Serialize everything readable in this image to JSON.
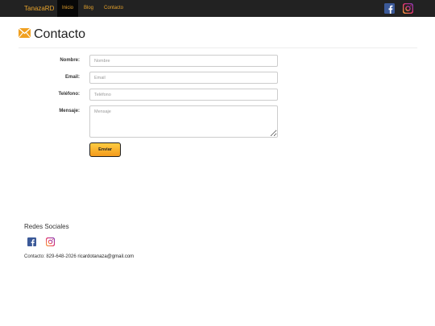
{
  "navbar": {
    "brand": "TanazaRD",
    "items": [
      {
        "label": "Inicio",
        "active": true
      },
      {
        "label": "Blog",
        "active": false
      },
      {
        "label": "Contacto",
        "active": false
      }
    ],
    "social_icons": [
      "facebook-icon",
      "instagram-icon"
    ],
    "accent_color": "#e7a32c",
    "background_color": "#222222"
  },
  "page": {
    "title": "Contacto",
    "title_icon": "envelope-icon",
    "title_icon_color": "#f0a020"
  },
  "form": {
    "name_label": "Nombre:",
    "name_placeholder": "Nombre",
    "email_label": "Email:",
    "email_placeholder": "Email",
    "phone_label": "Teléfono:",
    "phone_placeholder": "Teléfono",
    "message_label": "Mensaje:",
    "message_placeholder": "Mensaje",
    "submit_label": "Enviar",
    "submit_color": "#f7b432"
  },
  "footer": {
    "social_title": "Redes Sociales",
    "social_icons": [
      "facebook-icon",
      "instagram-icon"
    ],
    "contact_prefix": "Contacto: 829-648-2026",
    "contact_email": "ricardotanaza@gmail.com"
  }
}
